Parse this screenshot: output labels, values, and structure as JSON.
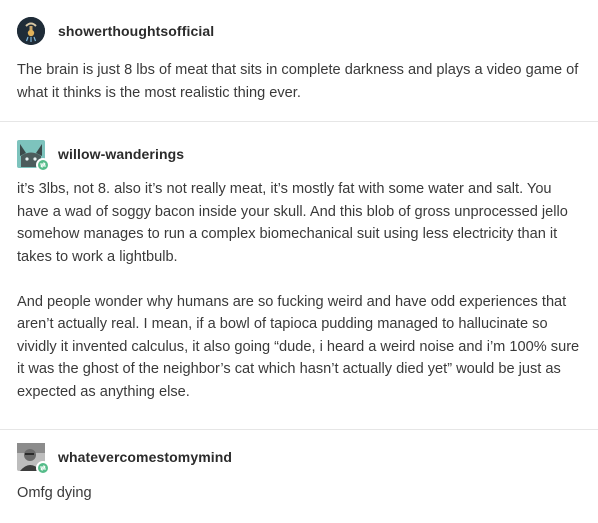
{
  "posts": [
    {
      "username": "showerthoughtsofficial",
      "avatar_icon": "showerhead-avatar-icon",
      "paragraphs": [
        "The brain is just 8 lbs of meat that sits in complete darkness and plays a video game of what it thinks is the most realistic thing ever."
      ]
    },
    {
      "username": "willow-wanderings",
      "avatar_icon": "cat-avatar-icon",
      "badge_icon": "follow-badge-icon",
      "paragraphs": [
        "it’s 3lbs, not 8. also it’s not really meat, it’s mostly fat with some water and salt. You have a wad of soggy bacon inside your skull. And this blob of gross unprocessed jello somehow manages to run a complex biomechanical suit using less electricity than it takes to work a lightbulb.",
        "And people wonder why humans are so fucking weird and have odd experiences that aren’t actually real. I mean, if a bowl of tapioca pudding managed to hallucinate so vividly it invented calculus, it also going “dude, i heard a weird noise and i’m 100% sure it was the ghost of the neighbor’s cat which hasn’t actually died yet” would be just as expected as anything else."
      ]
    },
    {
      "username": "whatevercomestomymind",
      "avatar_icon": "person-avatar-icon",
      "badge_icon": "follow-badge-icon",
      "paragraphs": [
        "Omfg dying"
      ]
    }
  ],
  "colors": {
    "text": "#3a3a3a",
    "username": "#2b2b2b",
    "divider": "#e6e6e6",
    "follow_badge": "#56bc8a"
  }
}
